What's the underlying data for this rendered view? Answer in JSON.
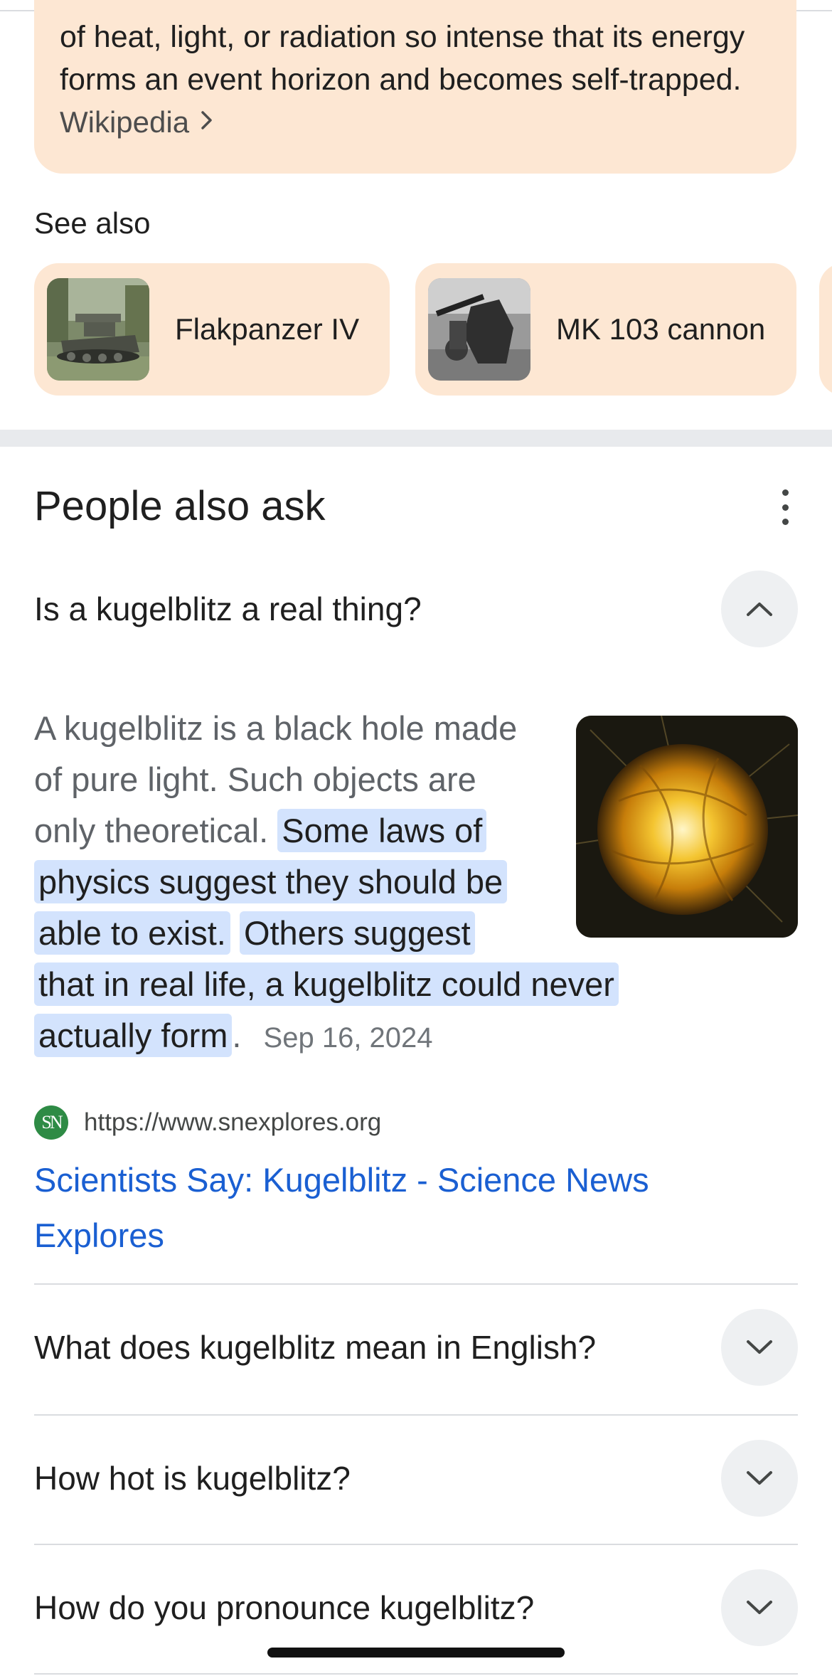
{
  "knowledge_panel": {
    "line_1": "of heat, light, or radiation so intense that its energy",
    "line_2": "forms an event horizon and becomes self-trapped.",
    "source": "Wikipedia"
  },
  "see_also": {
    "label": "See also",
    "items": [
      {
        "label": "Flakpanzer IV"
      },
      {
        "label": "MK 103 cannon"
      }
    ]
  },
  "people_also_ask": {
    "title": "People also ask",
    "expanded_question": "Is a kugelblitz a real thing?",
    "answer": {
      "line_1": "A kugelblitz is a black hole made",
      "line_2": "of pure light. Such objects are",
      "line_3_plain": "only theoretical.",
      "line_3_hl": "Some laws of",
      "line_4_hl": "physics suggest they should be",
      "line_5_hl_a": "able to exist.",
      "line_5_hl_b": "Others suggest",
      "line_6_hl": "that in real life, a kugelblitz could never",
      "line_7_hl": "actually form",
      "line_7_tail": ".",
      "date": "Sep 16, 2024"
    },
    "source": {
      "favicon_text": "SN",
      "url": "https://www.snexplores.org",
      "title": "Scientists Say: Kugelblitz - Science News Explores"
    },
    "questions": [
      {
        "text": "What does kugelblitz mean in English?"
      },
      {
        "text": "How hot is kugelblitz?"
      },
      {
        "text": "How do you pronounce kugelblitz?"
      }
    ]
  },
  "colors": {
    "card_bg": "#fde7d3",
    "highlight": "#d3e3fd",
    "link": "#1a5fd2",
    "toggle_bg": "#eef0f2"
  }
}
